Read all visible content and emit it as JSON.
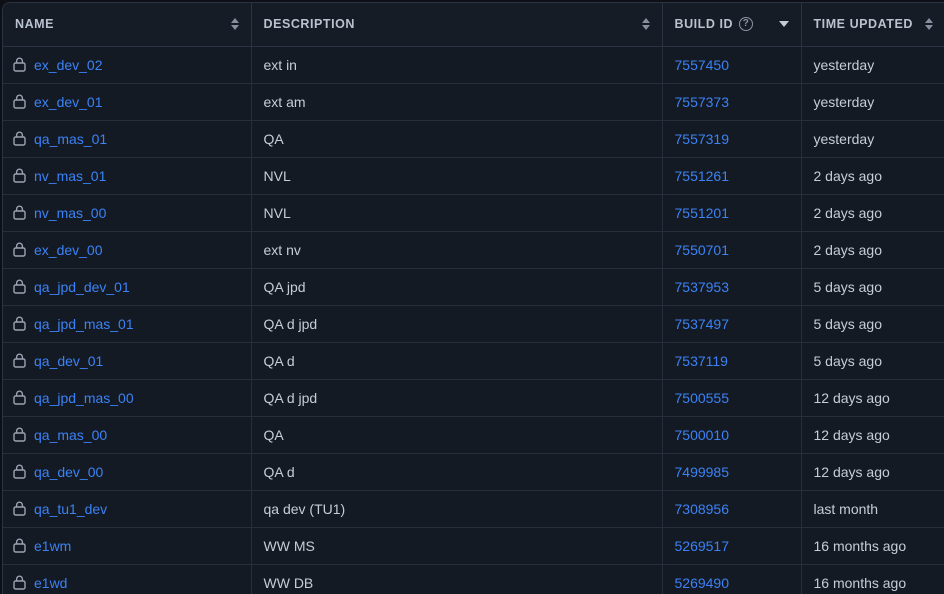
{
  "theme": {
    "page_bg": "#0d1117",
    "table_bg": "#141a23",
    "header_bg": "#161c26",
    "border": "#2b3442",
    "row_border": "#272f3c",
    "link": "#3b82f6",
    "text": "#c6cdd8",
    "header_text": "#b9c2cf",
    "icon": "#8b95a3"
  },
  "table": {
    "columns": [
      {
        "key": "name",
        "label": "NAME",
        "sortable": true,
        "sort_state": "none",
        "sort_icon": "sort-both-icon",
        "has_help": false
      },
      {
        "key": "description",
        "label": "DESCRIPTION",
        "sortable": true,
        "sort_state": "none",
        "sort_icon": "sort-both-icon",
        "has_help": false
      },
      {
        "key": "build_id",
        "label": "BUILD ID",
        "sortable": true,
        "sort_state": "descending",
        "sort_icon": "sort-descending-icon",
        "has_help": true,
        "help_icon": "help-circle-icon",
        "help_glyph": "?"
      },
      {
        "key": "time_updated",
        "label": "TIME UPDATED",
        "sortable": true,
        "sort_state": "none",
        "sort_icon": "sort-both-icon",
        "has_help": false
      }
    ],
    "row_icon": "lock-icon",
    "rows": [
      {
        "name": "ex_dev_02",
        "description": "ext in",
        "build_id": "7557450",
        "time_updated": "yesterday"
      },
      {
        "name": "ex_dev_01",
        "description": "ext am",
        "build_id": "7557373",
        "time_updated": "yesterday"
      },
      {
        "name": "qa_mas_01",
        "description": "QA",
        "build_id": "7557319",
        "time_updated": "yesterday"
      },
      {
        "name": "nv_mas_01",
        "description": "NVL",
        "build_id": "7551261",
        "time_updated": "2 days ago"
      },
      {
        "name": "nv_mas_00",
        "description": "NVL",
        "build_id": "7551201",
        "time_updated": "2 days ago"
      },
      {
        "name": "ex_dev_00",
        "description": "ext nv",
        "build_id": "7550701",
        "time_updated": "2 days ago"
      },
      {
        "name": "qa_jpd_dev_01",
        "description": "QA jpd",
        "build_id": "7537953",
        "time_updated": "5 days ago"
      },
      {
        "name": "qa_jpd_mas_01",
        "description": "QA d jpd",
        "build_id": "7537497",
        "time_updated": "5 days ago"
      },
      {
        "name": "qa_dev_01",
        "description": "QA d",
        "build_id": "7537119",
        "time_updated": "5 days ago"
      },
      {
        "name": "qa_jpd_mas_00",
        "description": "QA d jpd",
        "build_id": "7500555",
        "time_updated": "12 days ago"
      },
      {
        "name": "qa_mas_00",
        "description": "QA",
        "build_id": "7500010",
        "time_updated": "12 days ago"
      },
      {
        "name": "qa_dev_00",
        "description": "QA d",
        "build_id": "7499985",
        "time_updated": "12 days ago"
      },
      {
        "name": "qa_tu1_dev",
        "description": "qa dev (TU1)",
        "build_id": "7308956",
        "time_updated": "last month"
      },
      {
        "name": "e1wm",
        "description": "WW MS",
        "build_id": "5269517",
        "time_updated": "16 months ago"
      },
      {
        "name": "e1wd",
        "description": "WW DB",
        "build_id": "5269490",
        "time_updated": "16 months ago"
      }
    ]
  }
}
